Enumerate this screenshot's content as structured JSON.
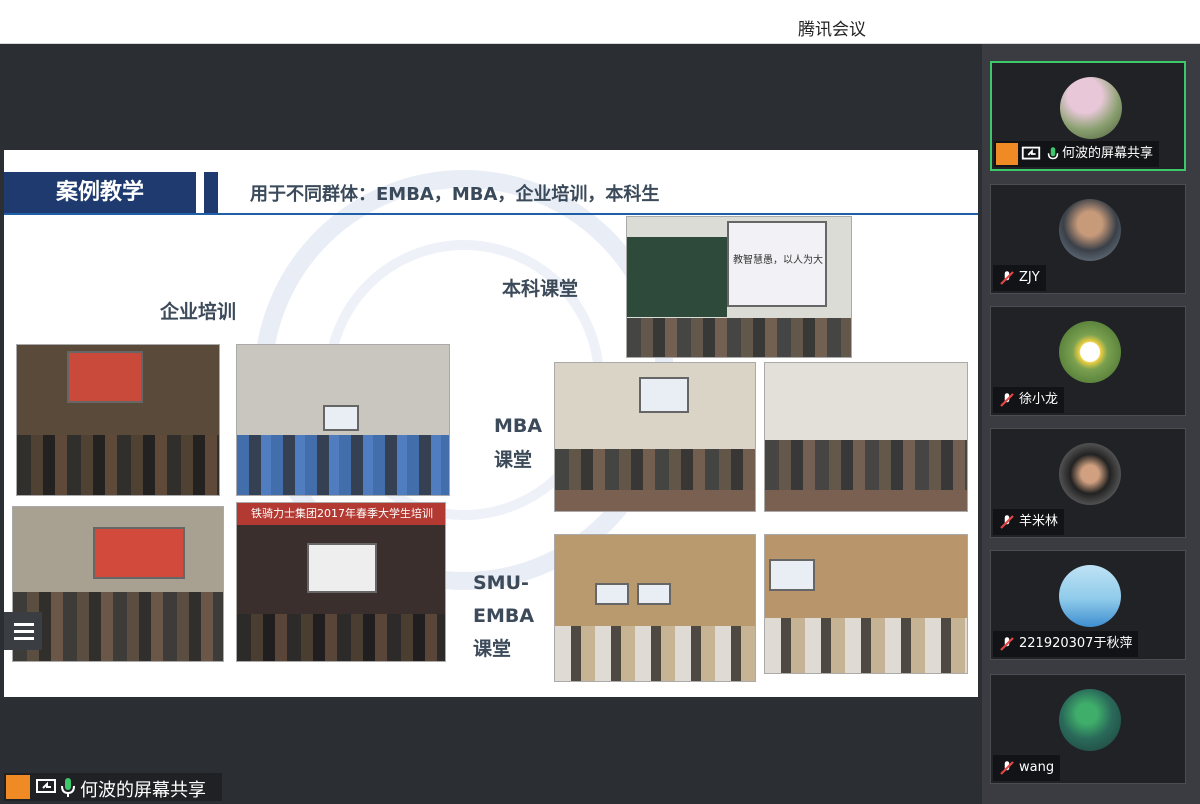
{
  "window": {
    "title": "腾讯会议"
  },
  "slide": {
    "heading": "案例教学",
    "subheading": "用于不同群体：EMBA，MBA，企业培训，本科生",
    "labels": {
      "corporate": "企业培训",
      "undergrad": "本科课堂",
      "mba_line1": "MBA",
      "mba_line2": "课堂",
      "emba_line1": "SMU-",
      "emba_line2": "EMBA",
      "emba_line3": "课堂"
    },
    "photo_texts": {
      "banner": "铁骑力士集团2017年春季大学生培训",
      "screen_text": "教智慧愚，以人为大"
    }
  },
  "share_indicator": {
    "label": "何波的屏幕共享"
  },
  "participants": [
    {
      "name": "何波的屏幕共享",
      "muted": false,
      "active": true
    },
    {
      "name": "ZJY",
      "muted": true,
      "active": false
    },
    {
      "name": "徐小龙",
      "muted": true,
      "active": false
    },
    {
      "name": "羊米林",
      "muted": true,
      "active": false
    },
    {
      "name": "221920307于秋萍",
      "muted": true,
      "active": false
    },
    {
      "name": "wang",
      "muted": true,
      "active": false
    }
  ],
  "colors": {
    "accent_green": "#3ec76b",
    "slide_navy": "#1e3a6e",
    "share_orange": "#f08a24"
  }
}
